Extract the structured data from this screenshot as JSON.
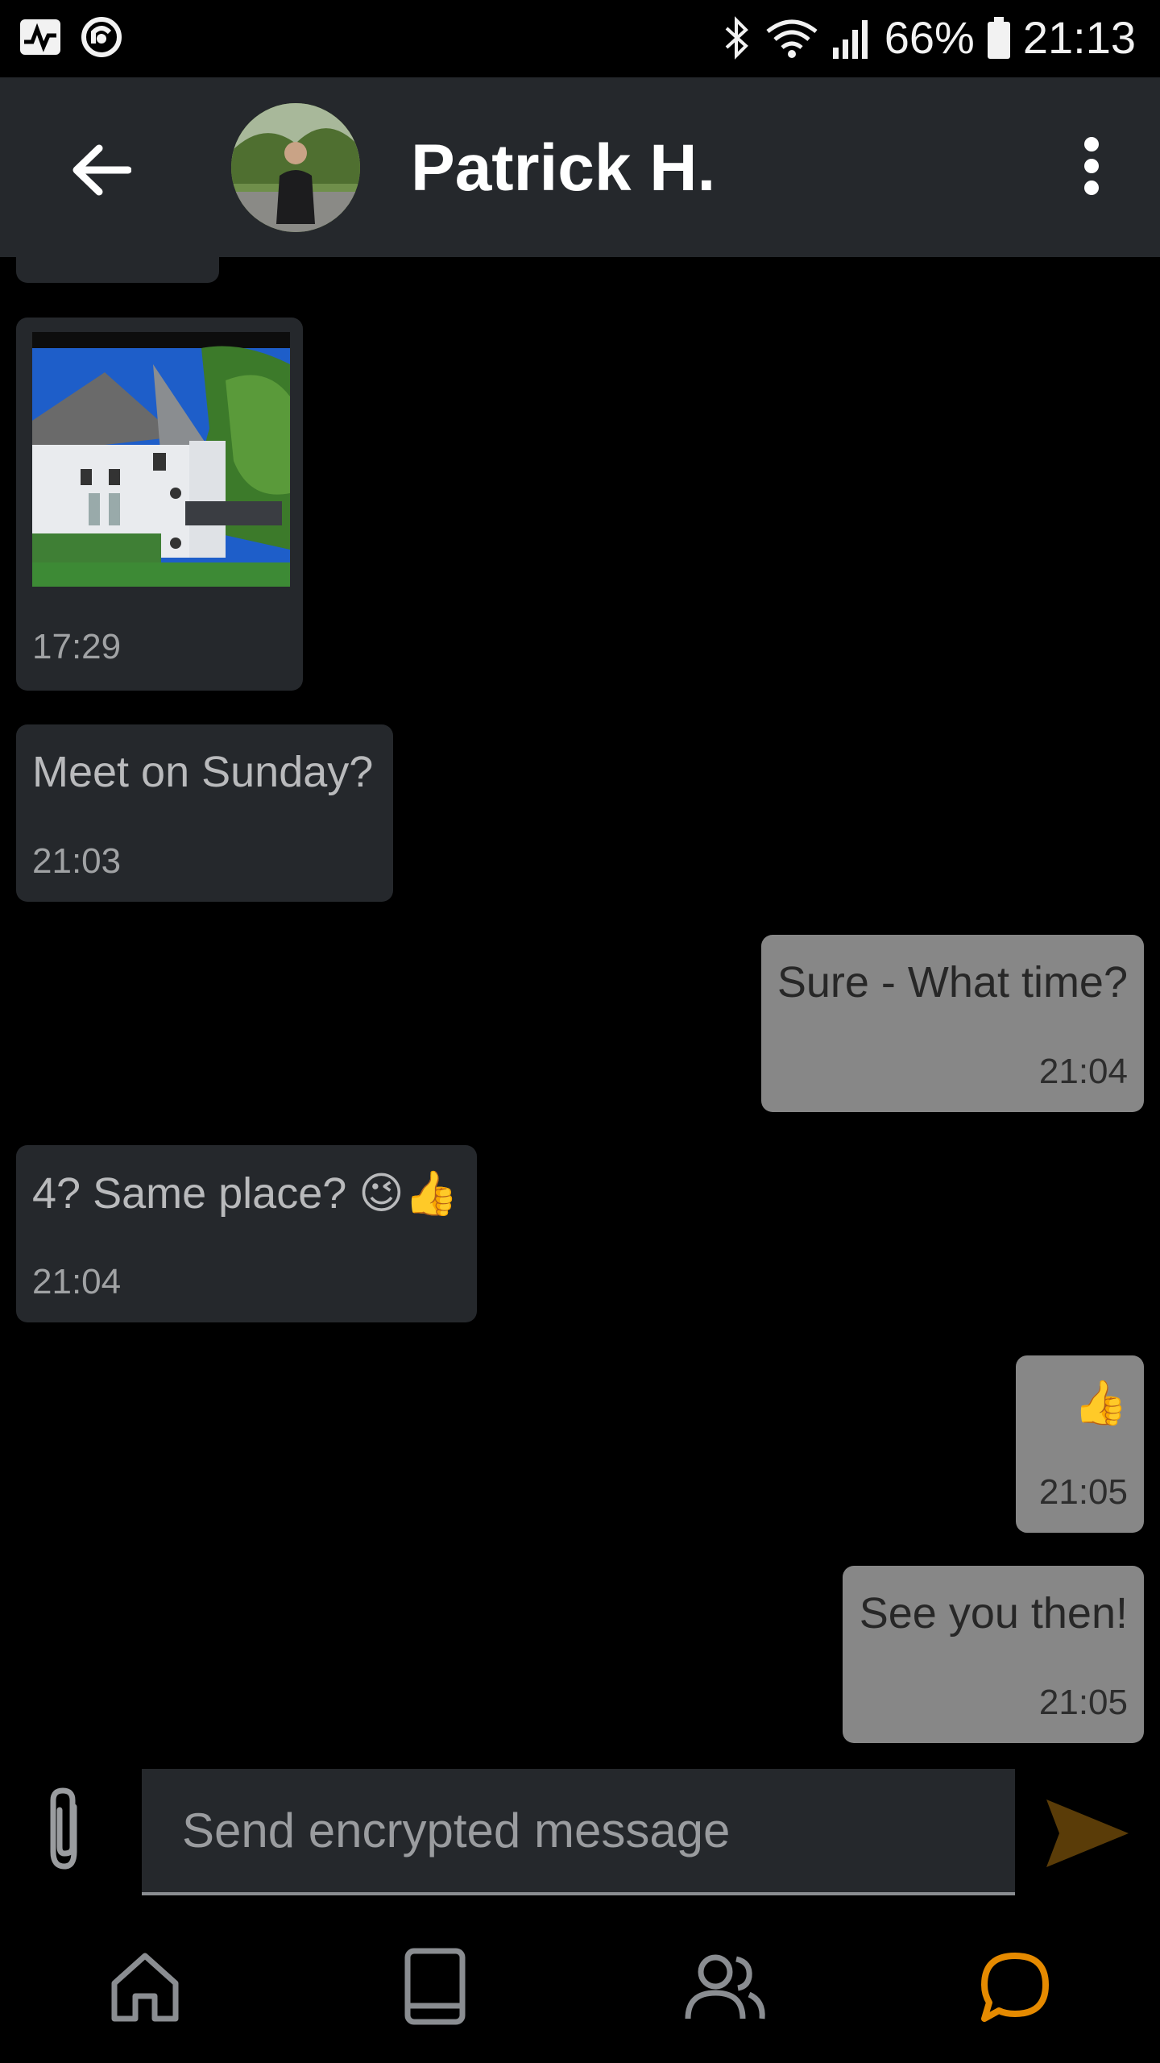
{
  "status_bar": {
    "battery": "66%",
    "time": "21:13",
    "icons": [
      "activity-icon",
      "sync-icon",
      "bluetooth-icon",
      "wifi-icon",
      "signal-icon",
      "battery-icon"
    ]
  },
  "header": {
    "title": "Patrick H.",
    "back_icon": "arrow-left-icon",
    "menu_icon": "more-vert-icon"
  },
  "messages": [
    {
      "direction": "incoming",
      "type": "image",
      "time": "17:29"
    },
    {
      "direction": "incoming",
      "text": "Meet on Sunday?",
      "time": "21:03"
    },
    {
      "direction": "outgoing",
      "text": "Sure - What time?",
      "time": "21:04"
    },
    {
      "direction": "incoming",
      "text": "4? Same place? 😉👍",
      "time": "21:04"
    },
    {
      "direction": "outgoing",
      "text": "👍",
      "time": "21:05"
    },
    {
      "direction": "outgoing",
      "text": "See you then!",
      "time": "21:05"
    }
  ],
  "compose": {
    "placeholder": "Send encrypted message",
    "attach_icon": "paperclip-icon",
    "send_icon": "send-icon"
  },
  "bottom_nav": [
    {
      "name": "home",
      "icon": "home-icon"
    },
    {
      "name": "book",
      "icon": "book-icon"
    },
    {
      "name": "contacts",
      "icon": "people-icon"
    },
    {
      "name": "chats",
      "icon": "chat-icon",
      "active": true
    }
  ],
  "colors": {
    "background": "#000000",
    "app_bar": "#25282c",
    "incoming_bubble": "#25282c",
    "outgoing_bubble": "#878787",
    "accent": "#e58a00",
    "send_disabled": "#5a3c08"
  }
}
